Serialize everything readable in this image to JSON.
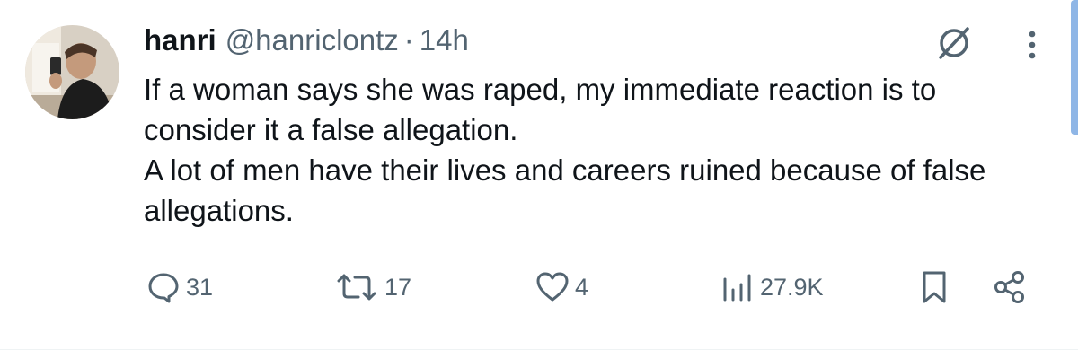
{
  "tweet": {
    "author": {
      "name": "hanri",
      "handle": "@hanriclontz",
      "separator": "·",
      "time": "14h"
    },
    "text_lines": [
      "If a woman says she was raped, my immediate reaction is to consider it a false allegation.",
      "A lot of men have their lives and careers ruined because of false allegations."
    ],
    "actions": {
      "replies": "31",
      "reposts": "17",
      "likes": "4",
      "views": "27.9K"
    }
  },
  "icons": {
    "top_right": [
      "grok-icon",
      "more-icon"
    ],
    "action_bar": [
      "reply-icon",
      "repost-icon",
      "like-icon",
      "views-icon",
      "bookmark-icon",
      "share-icon"
    ]
  },
  "colors": {
    "text_primary": "#0f1419",
    "text_secondary": "#536471",
    "scrollbar": "#8fb6e6"
  }
}
